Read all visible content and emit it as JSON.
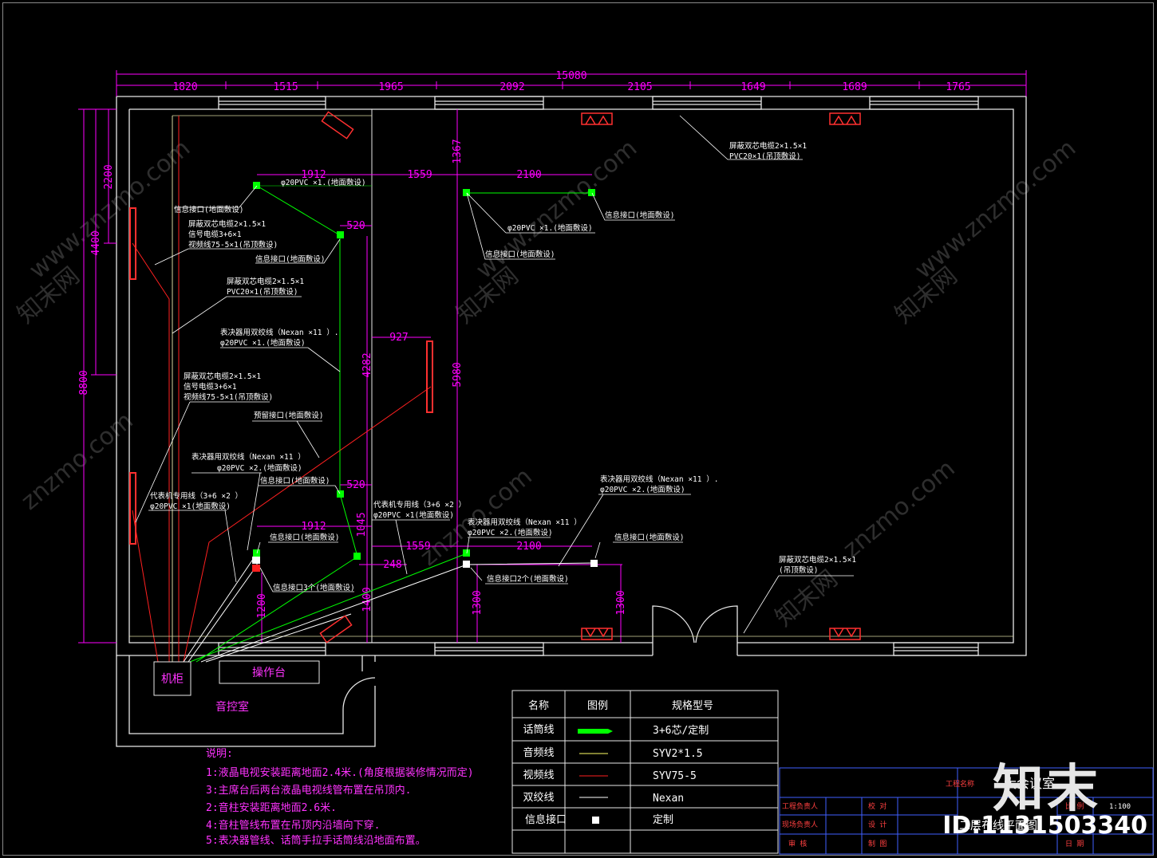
{
  "colors": {
    "background": "#000000",
    "wall": "#e8e8e8",
    "dimension": "#ff00ff",
    "annotation": "#ffffff",
    "mic_line": "#00ff00",
    "audio_line": "#ffff66",
    "video_line": "#ff2020",
    "twisted_pair": "#ffffff",
    "speaker": "#ff3030"
  },
  "dimensions": {
    "total_width": "15080",
    "top_segments": [
      "1820",
      "1515",
      "1965",
      "2092",
      "2105",
      "1649",
      "1689",
      "1765"
    ],
    "left_total": "8800",
    "left_a": "4400",
    "left_b": "2200",
    "upper": [
      "1912",
      "1559",
      "1367",
      "2100",
      "520"
    ],
    "middle": [
      "927",
      "4282",
      "5980"
    ],
    "lower": [
      "520",
      "1045",
      "1912",
      "1559",
      "2100",
      "248",
      "1200",
      "1400",
      "1300",
      "1300"
    ]
  },
  "annotations": {
    "a1": "屏蔽双芯电缆2×1.5×1",
    "a2": "PVC20×1(吊顶敷设)",
    "a3": "φ20PVC ×1.(地面敷设)",
    "a4": "信息接口(地面敷设)",
    "a5": "屏蔽双芯电缆2×1.5×1",
    "a6": "信号电缆3+6×1",
    "a7": "视频线75-5×1(吊顶敷设)",
    "a8": "信息接口(地面敷设)",
    "a9": "φ20PVC ×1.(地面敷设)",
    "a10": "信息接口(地面敷设)",
    "a11": "信息接口(地面敷设)",
    "a12": "屏蔽双芯电缆2×1.5×1",
    "a13": "PVC20×1(吊顶敷设)",
    "a14": "表决器用双绞线（Nexan ×11 ）.",
    "a15": "φ20PVC ×1.(地面敷设)",
    "a16": "屏蔽双芯电缆2×1.5×1",
    "a17": "信号电缆3+6×1",
    "a18": "视频线75-5×1(吊顶敷设)",
    "a19": "预留接口(地面敷设)",
    "a20": "表决器用双绞线（Nexan ×11 ）",
    "a21": "φ20PVC ×2.(地面敷设)",
    "a22": "信息接口(地面敷设)",
    "a23": "代表机专用线（3+6 ×2 ）",
    "a24": "φ20PVC ×1(地面敷设)",
    "a25": "代表机专用线（3+6 ×2 ）",
    "a26": "φ20PVC ×1(地面敷设)",
    "a27": "信息接口(地面敷设)",
    "a28": "信息接口3个(地面敷设)",
    "a29": "表决器用双绞线（Nexan ×11 ）",
    "a30": "φ20PVC ×2.(地面敷设)",
    "a31": "信息接口2个(地面敷设)",
    "a32": "表决器用双绞线（Nexan ×11 ）.",
    "a33": "φ20PVC ×2.(地面敷设)",
    "a34": "信息接口(地面敷设)",
    "a35": "屏蔽双芯电缆2×1.5×1",
    "a36": "(吊顶敷设)"
  },
  "rooms": {
    "cabinet": "机柜",
    "console": "操作台",
    "control_room": "音控室"
  },
  "legend": {
    "headers": [
      "名称",
      "图例",
      "规格型号"
    ],
    "rows": [
      {
        "name": "话筒线",
        "symbol": "mic-line",
        "spec": "3+6芯/定制"
      },
      {
        "name": "音频线",
        "symbol": "audio-line",
        "spec": "SYV2*1.5"
      },
      {
        "name": "视频线",
        "symbol": "video-line",
        "spec": "SYV75-5"
      },
      {
        "name": "双绞线",
        "symbol": "twisted-pair-line",
        "spec": "Nexan"
      },
      {
        "name": "信息接口",
        "symbol": "info-port",
        "spec": "定制"
      }
    ]
  },
  "notes": {
    "title": "说明:",
    "items": [
      "1:液晶电视安装距离地面2.4米.(角度根据装修情况而定)",
      "3:主席台后两台液晶电视线管布置在吊顶内.",
      "2:音柱安装距离地面2.6米.",
      "4:音柱管线布置在吊顶内沿墙向下穿.",
      "5:表决器管线、话筒手拉手话筒线沿地面布置。"
    ]
  },
  "title_block": {
    "project_label": "工程名称",
    "project_name": "大会议室",
    "drawing_name": "二层布线平面图",
    "rows_left": [
      "工程负责人",
      "现场负责人",
      "审  核"
    ],
    "rows_mid": [
      "校  对",
      "设  计",
      "制  图"
    ],
    "rows_right": [
      "比  例",
      "",
      "日  期"
    ],
    "scale": "1:100"
  },
  "watermark": {
    "site": "znzmo.com",
    "url": "www.znzmo.com",
    "brand": "知末网",
    "logo": "知末",
    "id": "ID:1131503340"
  }
}
